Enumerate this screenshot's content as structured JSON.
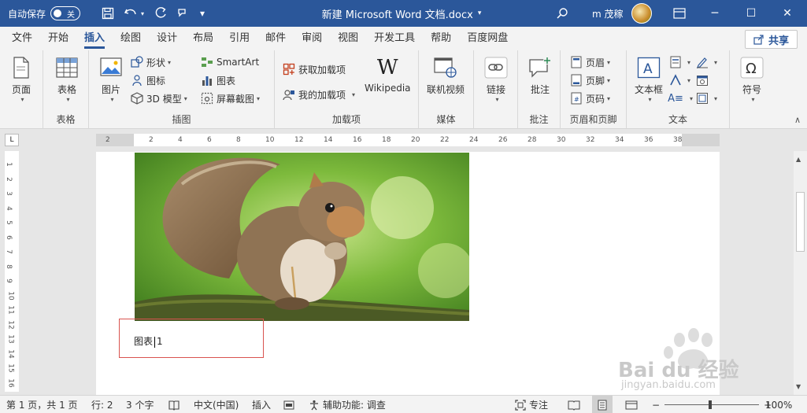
{
  "titlebar": {
    "autosave_label": "自动保存",
    "autosave_state": "关",
    "doc_title": "新建 Microsoft Word 文档.docx",
    "user_name": "m 茂稼",
    "ribbon_display_label": "",
    "accent_color": "#2b579a"
  },
  "tabs": [
    "文件",
    "开始",
    "插入",
    "绘图",
    "设计",
    "布局",
    "引用",
    "邮件",
    "审阅",
    "视图",
    "开发工具",
    "帮助",
    "百度网盘"
  ],
  "active_tab": "插入",
  "share_label": "共享",
  "ribbon": {
    "pages": {
      "button": "页面",
      "group": ""
    },
    "tables": {
      "button": "表格",
      "group": "表格"
    },
    "illustrations": {
      "group": "插图",
      "picture": "图片",
      "shapes": "形状",
      "icons": "图标",
      "model3d": "3D 模型",
      "smartart": "SmartArt",
      "chart": "图表",
      "screenshot": "屏幕截图"
    },
    "addins": {
      "group": "加载项",
      "get_addins": "获取加载项",
      "my_addins": "我的加载项",
      "wikipedia": "Wikipedia"
    },
    "media": {
      "group": "媒体",
      "online_video": "联机视频"
    },
    "links": {
      "button": "链接"
    },
    "comments": {
      "group": "批注",
      "button": "批注"
    },
    "header_footer": {
      "group": "页眉和页脚",
      "header": "页眉",
      "footer": "页脚",
      "page_number": "页码"
    },
    "text": {
      "group": "文本",
      "textbox": "文本框"
    },
    "symbols": {
      "button": "符号"
    }
  },
  "ruler_ticks": [
    "2",
    "2",
    "4",
    "6",
    "8",
    "10",
    "12",
    "14",
    "16",
    "18",
    "20",
    "22",
    "24",
    "26",
    "28",
    "30",
    "32",
    "34",
    "36",
    "38"
  ],
  "vruler_ticks": [
    "1",
    "2",
    "3",
    "4",
    "5",
    "6",
    "7",
    "8",
    "9",
    "10",
    "11",
    "12",
    "13",
    "14",
    "15",
    "16"
  ],
  "document": {
    "caption_label": "图表",
    "caption_number": "1"
  },
  "statusbar": {
    "page": "第 1 页，共 1 页",
    "line": "行: 2",
    "chars": "3 个字",
    "language": "中文(中国)",
    "mode": "插入",
    "accessibility": "辅助功能: 调查",
    "focus": "专注",
    "zoom": "100%"
  },
  "watermark": {
    "brand": "Bai du 经验",
    "url": "jingyan.baidu.com"
  }
}
